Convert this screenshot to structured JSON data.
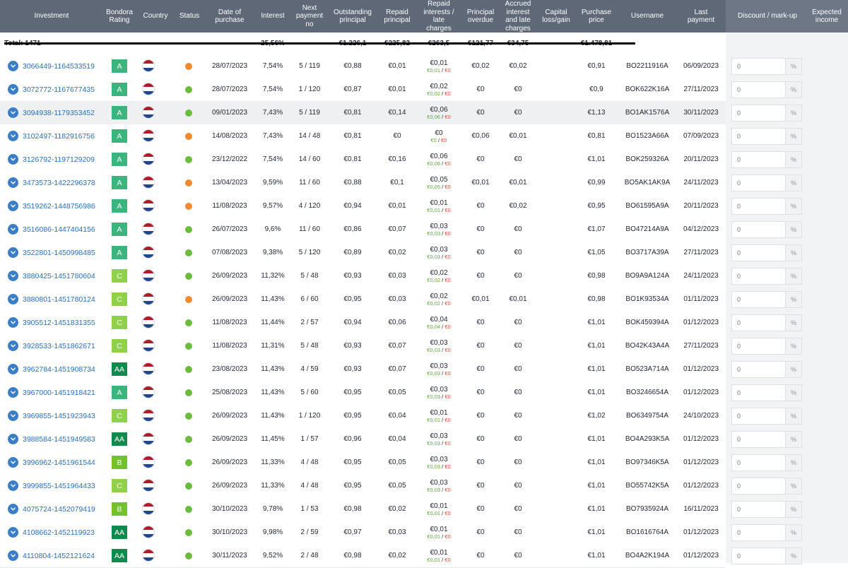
{
  "columns": {
    "investment": "Investment",
    "rating": "Bondora\nRating",
    "country": "Country",
    "status": "Status",
    "date": "Date of\npurchase",
    "interest": "Interest",
    "next_payment": "Next\npayment\nno",
    "outstanding": "Outstanding\nprincipal",
    "repaid_principal": "Repaid\nprincipal",
    "repaid_interest": "Repaid\ninterests /\nlate\ncharges",
    "principal_overdue": "Principal\noverdue",
    "accrued": "Accrued\ninterest\nand late\ncharges",
    "capital": "Capital\nloss/gain",
    "purchase_price": "Purchase\nprice",
    "username": "Username",
    "last_payment": "Last\npayment",
    "discount": "Discount / mark-up",
    "expected": "Expected\nincome"
  },
  "totals": {
    "label": "Total: 1471",
    "interest": "25,56%",
    "outstanding": "€1.226,1",
    "repaid_principal": "€225,82",
    "repaid_interest": "€263,5",
    "principal_overdue": "€121,77",
    "accrued": "€34,75",
    "purchase_price": "€1.478,81"
  },
  "colors": {
    "header": "#5e6876",
    "link": "#2d6fb8",
    "rating_A": "#3bb47e",
    "rating_AA": "#0e8a4c",
    "rating_B": "#74c22b",
    "rating_C": "#8fd14b",
    "status_green": "#6bbb3f",
    "status_orange": "#f2892e"
  },
  "discount_placeholder": "0",
  "discount_unit": "%",
  "rows": [
    {
      "id": "3066449-1164533519",
      "rating": "A",
      "status": "orange",
      "date": "28/07/2023",
      "interest": "7,54%",
      "next": "5 / 119",
      "outstanding": "€0,88",
      "repaid_principal": "€0,01",
      "repaid_interest": "€0,01",
      "ri_a": "€0,01",
      "ri_b": "€0",
      "overdue": "€0,02",
      "accrued": "€0,02",
      "capital": "",
      "price": "€0,91",
      "username": "BO2211916A",
      "last": "06/09/2023"
    },
    {
      "id": "3072772-1167677435",
      "rating": "A",
      "status": "green",
      "date": "28/07/2023",
      "interest": "7,54%",
      "next": "1 / 120",
      "outstanding": "€0,87",
      "repaid_principal": "€0,01",
      "repaid_interest": "€0,02",
      "ri_a": "€0,02",
      "ri_b": "€0",
      "overdue": "€0",
      "accrued": "€0",
      "capital": "",
      "price": "€0,9",
      "username": "BOK622K16A",
      "last": "27/11/2023"
    },
    {
      "id": "3094938-1179353452",
      "rating": "A",
      "status": "green",
      "date": "09/01/2023",
      "interest": "7,43%",
      "next": "5 / 119",
      "outstanding": "€0,81",
      "repaid_principal": "€0,14",
      "repaid_interest": "€0,06",
      "ri_a": "€0,06",
      "ri_b": "€0",
      "overdue": "€0",
      "accrued": "€0",
      "capital": "",
      "price": "€1,13",
      "username": "BO1AK1576A",
      "last": "30/11/2023",
      "hl": true
    },
    {
      "id": "3102497-1182916756",
      "rating": "A",
      "status": "orange",
      "date": "14/08/2023",
      "interest": "7,43%",
      "next": "14 / 48",
      "outstanding": "€0,81",
      "repaid_principal": "€0",
      "repaid_interest": "€0",
      "ri_a": "€0",
      "ri_b": "€0",
      "overdue": "€0,06",
      "accrued": "€0,01",
      "capital": "",
      "price": "€0,81",
      "username": "BO1523A66A",
      "last": "07/09/2023"
    },
    {
      "id": "3126792-1197129209",
      "rating": "A",
      "status": "green",
      "date": "23/12/2022",
      "interest": "7,54%",
      "next": "14 / 60",
      "outstanding": "€0,81",
      "repaid_principal": "€0,16",
      "repaid_interest": "€0,06",
      "ri_a": "€0,06",
      "ri_b": "€0",
      "overdue": "€0",
      "accrued": "€0",
      "capital": "",
      "price": "€1,01",
      "username": "BOK259326A",
      "last": "20/11/2023"
    },
    {
      "id": "3473573-1422296378",
      "rating": "A",
      "status": "orange",
      "date": "13/04/2023",
      "interest": "9,59%",
      "next": "11 / 60",
      "outstanding": "€0,88",
      "repaid_principal": "€0,1",
      "repaid_interest": "€0,05",
      "ri_a": "€0,05",
      "ri_b": "€0",
      "overdue": "€0,01",
      "accrued": "€0,01",
      "capital": "",
      "price": "€0,99",
      "username": "BO5AK1AK9A",
      "last": "24/11/2023"
    },
    {
      "id": "3519262-1448756986",
      "rating": "A",
      "status": "orange",
      "date": "11/08/2023",
      "interest": "9,57%",
      "next": "4 / 120",
      "outstanding": "€0,94",
      "repaid_principal": "€0,01",
      "repaid_interest": "€0,01",
      "ri_a": "€0,01",
      "ri_b": "€0",
      "overdue": "€0",
      "accrued": "€0,02",
      "capital": "",
      "price": "€0,95",
      "username": "BO61595A9A",
      "last": "20/11/2023"
    },
    {
      "id": "3516086-1447404156",
      "rating": "A",
      "status": "green",
      "date": "26/07/2023",
      "interest": "9,6%",
      "next": "11 / 60",
      "outstanding": "€0,86",
      "repaid_principal": "€0,07",
      "repaid_interest": "€0,03",
      "ri_a": "€0,03",
      "ri_b": "€0",
      "overdue": "€0",
      "accrued": "€0",
      "capital": "",
      "price": "€1,07",
      "username": "BO47214A9A",
      "last": "04/12/2023"
    },
    {
      "id": "3522801-1450998485",
      "rating": "A",
      "status": "green",
      "date": "07/08/2023",
      "interest": "9,38%",
      "next": "5 / 120",
      "outstanding": "€0,89",
      "repaid_principal": "€0,02",
      "repaid_interest": "€0,03",
      "ri_a": "€0,03",
      "ri_b": "€0",
      "overdue": "€0",
      "accrued": "€0",
      "capital": "",
      "price": "€1,05",
      "username": "BO3717A39A",
      "last": "27/11/2023"
    },
    {
      "id": "3880425-1451780604",
      "rating": "C",
      "status": "green",
      "date": "26/09/2023",
      "interest": "11,32%",
      "next": "5 / 48",
      "outstanding": "€0,93",
      "repaid_principal": "€0,03",
      "repaid_interest": "€0,02",
      "ri_a": "€0,02",
      "ri_b": "€0",
      "overdue": "€0",
      "accrued": "€0",
      "capital": "",
      "price": "€0,98",
      "username": "BO9A9A124A",
      "last": "24/11/2023"
    },
    {
      "id": "3880801-1451780124",
      "rating": "C",
      "status": "orange",
      "date": "26/09/2023",
      "interest": "11,43%",
      "next": "6 / 60",
      "outstanding": "€0,95",
      "repaid_principal": "€0,03",
      "repaid_interest": "€0,02",
      "ri_a": "€0,02",
      "ri_b": "€0",
      "overdue": "€0,01",
      "accrued": "€0,01",
      "capital": "",
      "price": "€0,98",
      "username": "BO1K93534A",
      "last": "01/11/2023"
    },
    {
      "id": "3905512-1451831355",
      "rating": "C",
      "status": "green",
      "date": "11/08/2023",
      "interest": "11,44%",
      "next": "2 / 57",
      "outstanding": "€0,94",
      "repaid_principal": "€0,06",
      "repaid_interest": "€0,04",
      "ri_a": "€0,04",
      "ri_b": "€0",
      "overdue": "€0",
      "accrued": "€0",
      "capital": "",
      "price": "€1,01",
      "username": "BOK459394A",
      "last": "01/12/2023"
    },
    {
      "id": "3928533-1451862671",
      "rating": "C",
      "status": "green",
      "date": "11/08/2023",
      "interest": "11,31%",
      "next": "5 / 48",
      "outstanding": "€0,93",
      "repaid_principal": "€0,07",
      "repaid_interest": "€0,03",
      "ri_a": "€0,03",
      "ri_b": "€0",
      "overdue": "€0",
      "accrued": "€0",
      "capital": "",
      "price": "€1,01",
      "username": "BO42K43A4A",
      "last": "27/11/2023"
    },
    {
      "id": "3962784-1451908734",
      "rating": "AA",
      "status": "green",
      "date": "23/08/2023",
      "interest": "11,43%",
      "next": "4 / 59",
      "outstanding": "€0,93",
      "repaid_principal": "€0,07",
      "repaid_interest": "€0,03",
      "ri_a": "€0,03",
      "ri_b": "€0",
      "overdue": "€0",
      "accrued": "€0",
      "capital": "",
      "price": "€1,01",
      "username": "BO523A714A",
      "last": "01/12/2023"
    },
    {
      "id": "3967000-1451918421",
      "rating": "A",
      "status": "green",
      "date": "25/08/2023",
      "interest": "11,43%",
      "next": "5 / 60",
      "outstanding": "€0,95",
      "repaid_principal": "€0,05",
      "repaid_interest": "€0,03",
      "ri_a": "€0,03",
      "ri_b": "€0",
      "overdue": "€0",
      "accrued": "€0",
      "capital": "",
      "price": "€1,01",
      "username": "BO3246654A",
      "last": "01/12/2023"
    },
    {
      "id": "3969855-1451923943",
      "rating": "C",
      "status": "green",
      "date": "26/09/2023",
      "interest": "11,43%",
      "next": "1 / 120",
      "outstanding": "€0,95",
      "repaid_principal": "€0,04",
      "repaid_interest": "€0,01",
      "ri_a": "€0,01",
      "ri_b": "€0",
      "overdue": "€0",
      "accrued": "€0",
      "capital": "",
      "price": "€1,02",
      "username": "BO6349754A",
      "last": "24/10/2023"
    },
    {
      "id": "3988584-1451949583",
      "rating": "AA",
      "status": "green",
      "date": "26/09/2023",
      "interest": "11,45%",
      "next": "1 / 57",
      "outstanding": "€0,96",
      "repaid_principal": "€0,04",
      "repaid_interest": "€0,03",
      "ri_a": "€0,03",
      "ri_b": "€0",
      "overdue": "€0",
      "accrued": "€0",
      "capital": "",
      "price": "€1,01",
      "username": "BO4A293K5A",
      "last": "01/12/2023"
    },
    {
      "id": "3996962-1451961544",
      "rating": "B",
      "status": "green",
      "date": "26/09/2023",
      "interest": "11,33%",
      "next": "4 / 48",
      "outstanding": "€0,95",
      "repaid_principal": "€0,05",
      "repaid_interest": "€0,03",
      "ri_a": "€0,03",
      "ri_b": "€0",
      "overdue": "€0",
      "accrued": "€0",
      "capital": "",
      "price": "€1,01",
      "username": "BO97346K5A",
      "last": "01/12/2023"
    },
    {
      "id": "3999855-1451964433",
      "rating": "C",
      "status": "green",
      "date": "26/09/2023",
      "interest": "11,33%",
      "next": "4 / 48",
      "outstanding": "€0,95",
      "repaid_principal": "€0,05",
      "repaid_interest": "€0,03",
      "ri_a": "€0,03",
      "ri_b": "€0",
      "overdue": "€0",
      "accrued": "€0",
      "capital": "",
      "price": "€1,01",
      "username": "BO55742K5A",
      "last": "01/12/2023"
    },
    {
      "id": "4075724-1452079419",
      "rating": "B",
      "status": "green",
      "date": "30/10/2023",
      "interest": "9,78%",
      "next": "1 / 53",
      "outstanding": "€0,98",
      "repaid_principal": "€0,02",
      "repaid_interest": "€0,01",
      "ri_a": "€0,01",
      "ri_b": "€0",
      "overdue": "€0",
      "accrued": "€0",
      "capital": "",
      "price": "€1,01",
      "username": "BO7935924A",
      "last": "16/11/2023"
    },
    {
      "id": "4108662-1452119923",
      "rating": "AA",
      "status": "green",
      "date": "30/10/2023",
      "interest": "9,98%",
      "next": "2 / 59",
      "outstanding": "€0,97",
      "repaid_principal": "€0,03",
      "repaid_interest": "€0,01",
      "ri_a": "€0,01",
      "ri_b": "€0",
      "overdue": "€0",
      "accrued": "€0",
      "capital": "",
      "price": "€1,01",
      "username": "BO1616764A",
      "last": "01/12/2023"
    },
    {
      "id": "4110804-1452121624",
      "rating": "AA",
      "status": "green",
      "date": "30/11/2023",
      "interest": "9,52%",
      "next": "2 / 48",
      "outstanding": "€0,98",
      "repaid_principal": "€0,02",
      "repaid_interest": "€0,01",
      "ri_a": "€0,01",
      "ri_b": "€0",
      "overdue": "€0",
      "accrued": "€0",
      "capital": "",
      "price": "€1,01",
      "username": "BO4A2K194A",
      "last": "01/12/2023"
    }
  ]
}
